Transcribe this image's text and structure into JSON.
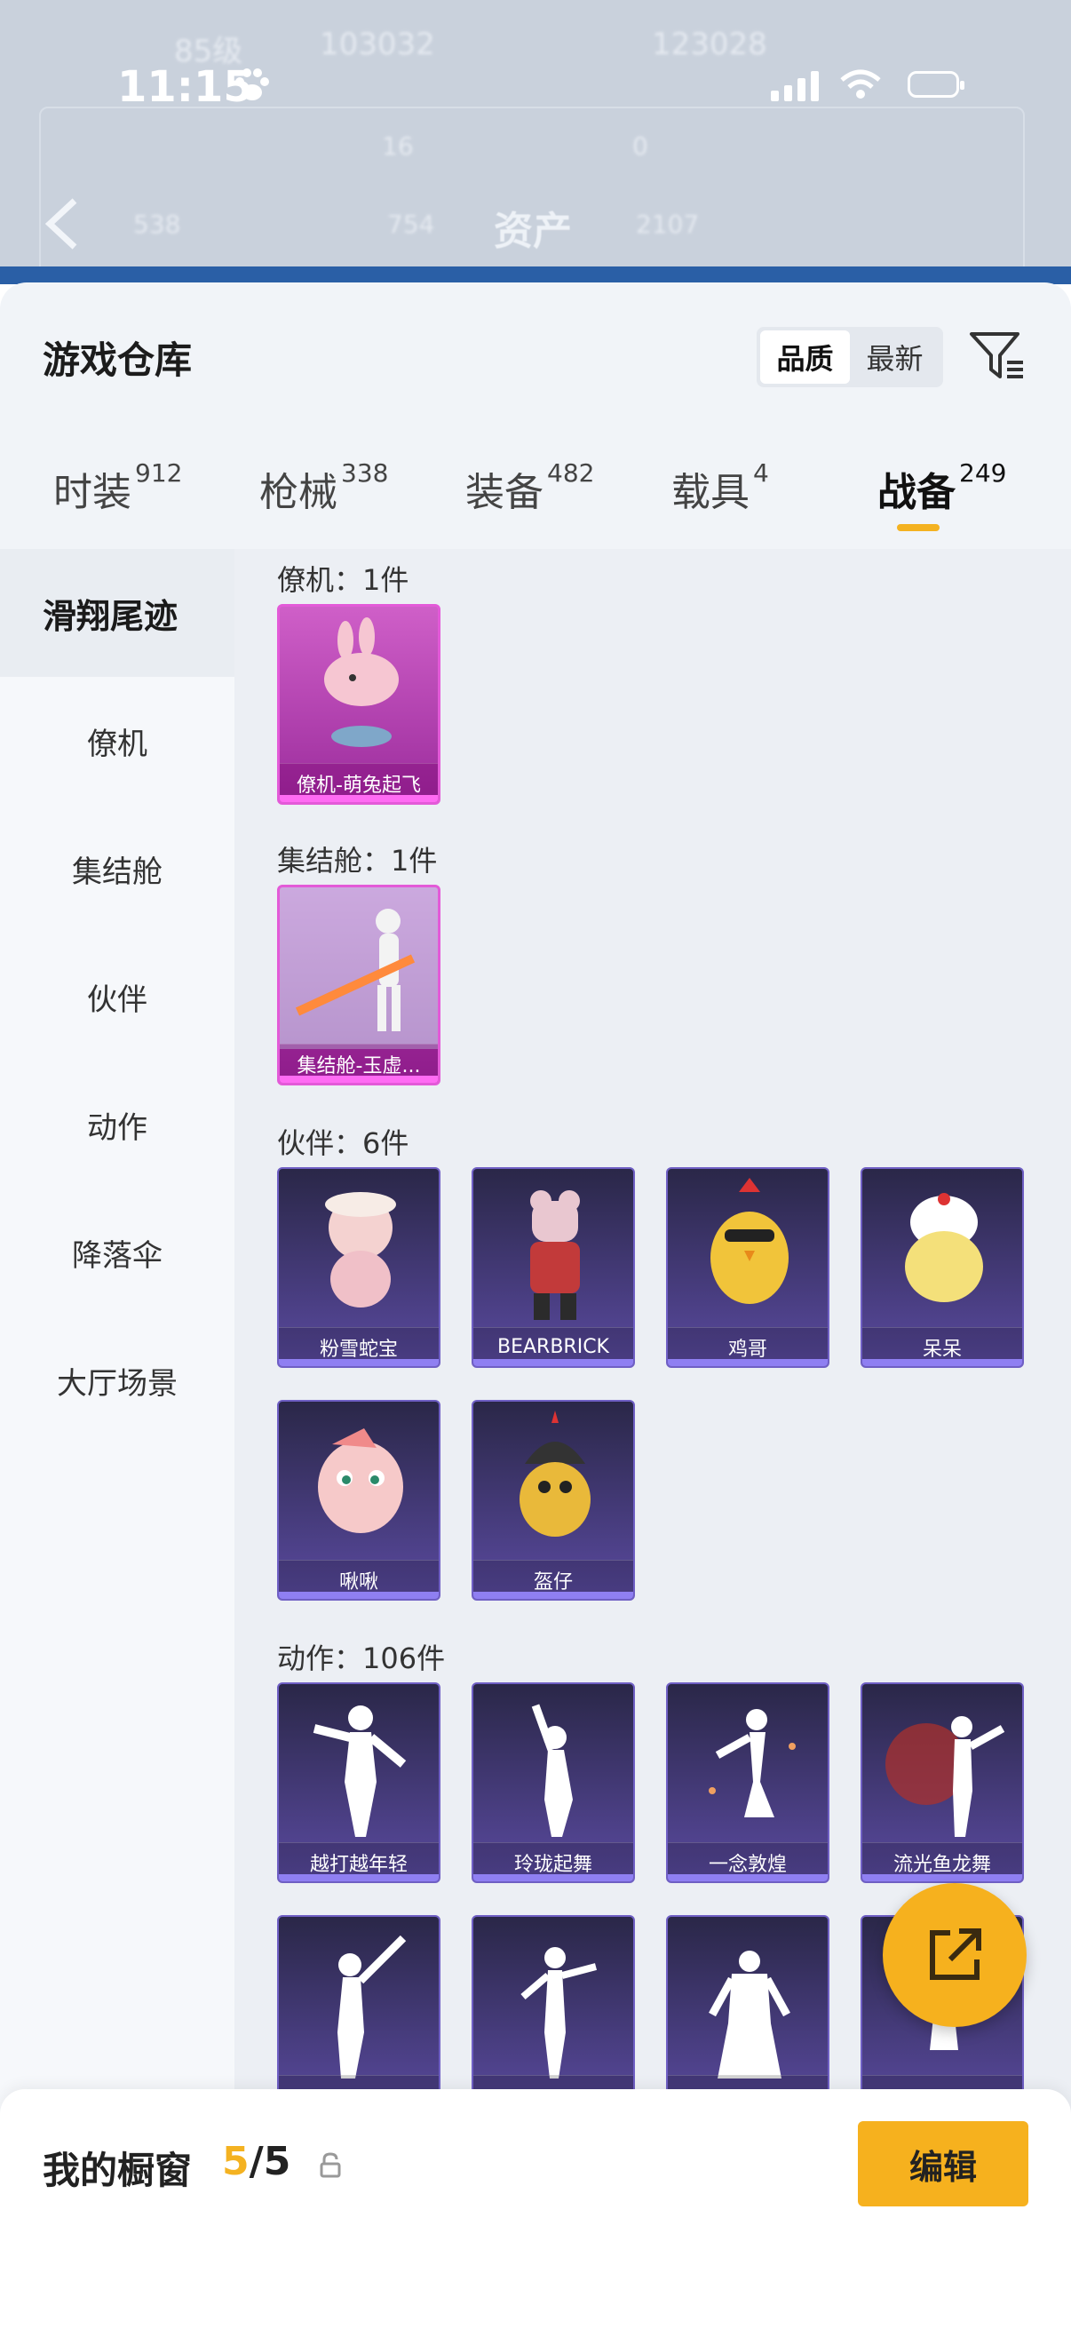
{
  "status_bar": {
    "time": "11:15"
  },
  "background": {
    "title": "资产",
    "level": "85级",
    "id_value": "103032",
    "id_value_2": "123028",
    "stats": [
      "16",
      "0",
      "538",
      "754",
      "2107"
    ]
  },
  "sheet": {
    "title": "游戏仓库"
  },
  "sort": {
    "options": [
      "品质",
      "最新"
    ],
    "active": "品质"
  },
  "tabs": [
    {
      "label": "时装",
      "count": "912"
    },
    {
      "label": "枪械",
      "count": "338"
    },
    {
      "label": "装备",
      "count": "482"
    },
    {
      "label": "载具",
      "count": "4"
    },
    {
      "label": "战备",
      "count": "249"
    }
  ],
  "active_tab": "战备",
  "sidebar": {
    "items": [
      {
        "label": "滑翔尾迹"
      },
      {
        "label": "僚机"
      },
      {
        "label": "集结舱"
      },
      {
        "label": "伙伴"
      },
      {
        "label": "动作"
      },
      {
        "label": "降落伞"
      },
      {
        "label": "大厅场景"
      }
    ],
    "active": "滑翔尾迹"
  },
  "sections": [
    {
      "title": "僚机：1件",
      "items": [
        {
          "name": "僚机-萌兔起飞"
        }
      ]
    },
    {
      "title": "集结舱：1件",
      "items": [
        {
          "name": "集结舱-玉虚..."
        }
      ]
    },
    {
      "title": "伙伴：6件",
      "items": [
        {
          "name": "粉雪蛇宝"
        },
        {
          "name": "BEARBRICK"
        },
        {
          "name": "鸡哥"
        },
        {
          "name": "呆呆"
        },
        {
          "name": "啾啾"
        },
        {
          "name": "盔仔"
        }
      ]
    },
    {
      "title": "动作：106件",
      "items": [
        {
          "name": "越打越年轻"
        },
        {
          "name": "玲珑起舞"
        },
        {
          "name": "一念敦煌"
        },
        {
          "name": "流光鱼龙舞"
        },
        {
          "name": ""
        },
        {
          "name": ""
        },
        {
          "name": ""
        },
        {
          "name": ""
        }
      ]
    }
  ],
  "showcase": {
    "label": "我的橱窗",
    "used": "5",
    "slash": "/",
    "total": "5",
    "edit_label": "编辑"
  },
  "colors": {
    "accent": "#f6b11e",
    "pink_card": "#cf5fc8",
    "purple_card": "#4b3f8c"
  },
  "icons": [
    "paw-icon",
    "signal-icon",
    "wifi-icon",
    "battery-icon",
    "back-icon",
    "filter-icon",
    "lock-icon",
    "share-icon"
  ]
}
